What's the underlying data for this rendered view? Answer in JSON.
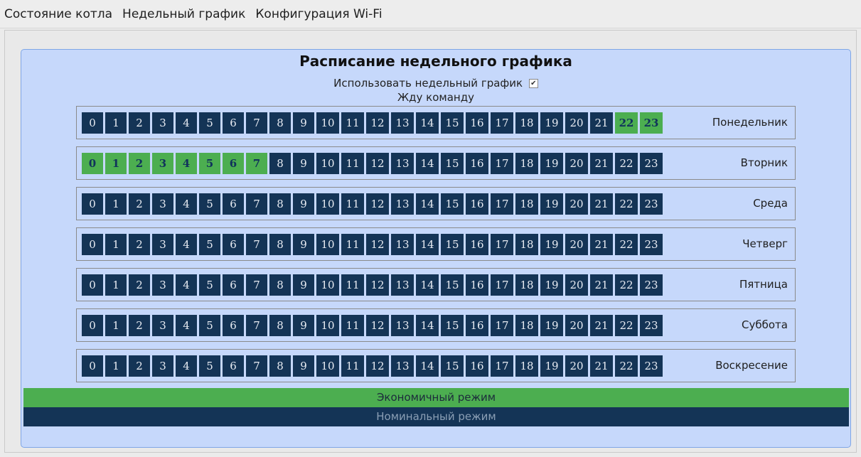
{
  "menu": {
    "items": [
      "Состояние котла",
      "Недельный график",
      "Конфигурация Wi-Fi"
    ]
  },
  "title": "Расписание недельного графика",
  "use_schedule": {
    "label": "Использовать недельный график",
    "checked": true
  },
  "status": "Жду команду",
  "hours": [
    "0",
    "1",
    "2",
    "3",
    "4",
    "5",
    "6",
    "7",
    "8",
    "9",
    "10",
    "11",
    "12",
    "13",
    "14",
    "15",
    "16",
    "17",
    "18",
    "19",
    "20",
    "21",
    "22",
    "23"
  ],
  "days": [
    {
      "name": "Понедельник",
      "on_hours": [
        22,
        23
      ]
    },
    {
      "name": "Вторник",
      "on_hours": [
        0,
        1,
        2,
        3,
        4,
        5,
        6,
        7
      ]
    },
    {
      "name": "Среда",
      "on_hours": []
    },
    {
      "name": "Четверг",
      "on_hours": []
    },
    {
      "name": "Пятница",
      "on_hours": []
    },
    {
      "name": "Суббота",
      "on_hours": []
    },
    {
      "name": "Воскресение",
      "on_hours": []
    }
  ],
  "legend": {
    "eco": "Экономичный режим",
    "nominal": "Номинальный режим"
  },
  "colors": {
    "eco": "#4cae50",
    "nominal": "#143456",
    "panel": "#c6d8fb"
  }
}
